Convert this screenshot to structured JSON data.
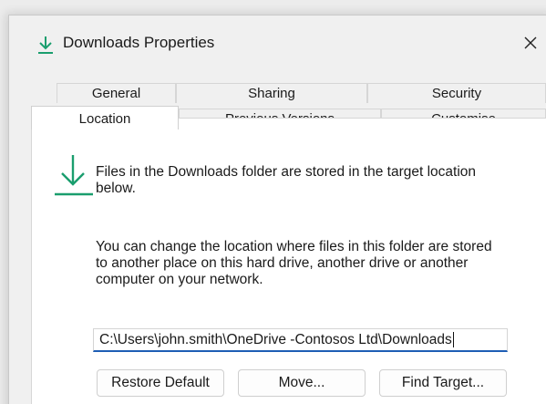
{
  "window": {
    "title": "Downloads Properties",
    "icon": "download-arrow-icon",
    "close_icon": "close-icon",
    "accent_color": "#1a9e6e"
  },
  "tabs": {
    "row1": [
      {
        "label": "General"
      },
      {
        "label": "Sharing"
      },
      {
        "label": "Security"
      }
    ],
    "row2": [
      {
        "label": "Location",
        "active": true
      },
      {
        "label": "Previous Versions"
      },
      {
        "label": "Customise"
      }
    ]
  },
  "location": {
    "info_text": "Files in the Downloads folder are stored in the target location below.",
    "description": "You can change the location where files in this folder are stored to another place on this hard drive, another drive or another computer on your network.",
    "path_value": "C:\\Users\\john.smith\\OneDrive -Contosos Ltd\\Downloads",
    "buttons": {
      "restore_default": "Restore Default",
      "move": "Move...",
      "find_target": "Find Target..."
    }
  }
}
